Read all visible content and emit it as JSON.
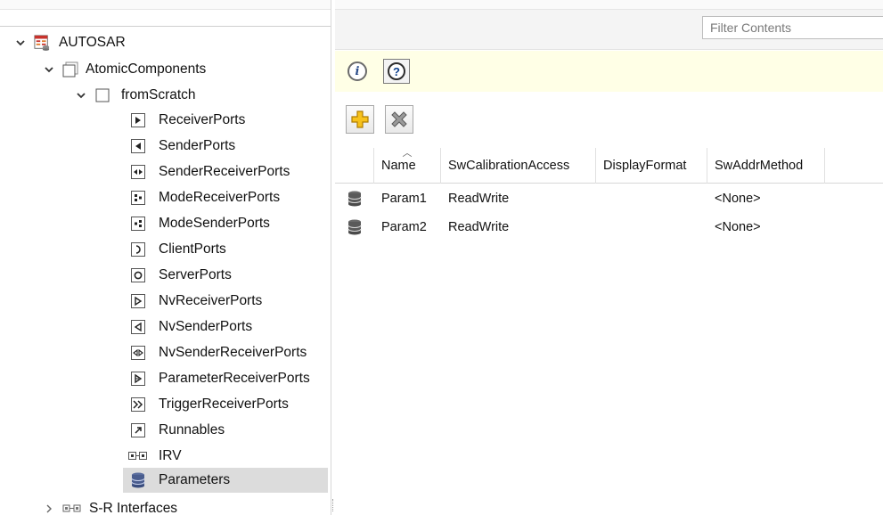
{
  "tree": {
    "nodes": [
      {
        "label": "AUTOSAR",
        "icon": "autosar-package-icon",
        "expanded": true
      },
      {
        "label": "AtomicComponents",
        "icon": "folder-outline-icon",
        "expanded": true
      },
      {
        "label": "fromScratch",
        "icon": "component-icon",
        "expanded": true
      },
      {
        "label": "ReceiverPorts",
        "icon": "receiver-port-icon"
      },
      {
        "label": "SenderPorts",
        "icon": "sender-port-icon"
      },
      {
        "label": "SenderReceiverPorts",
        "icon": "sender-receiver-port-icon"
      },
      {
        "label": "ModeReceiverPorts",
        "icon": "mode-receiver-port-icon"
      },
      {
        "label": "ModeSenderPorts",
        "icon": "mode-sender-port-icon"
      },
      {
        "label": "ClientPorts",
        "icon": "client-port-icon"
      },
      {
        "label": "ServerPorts",
        "icon": "server-port-icon"
      },
      {
        "label": "NvReceiverPorts",
        "icon": "nv-receiver-port-icon"
      },
      {
        "label": "NvSenderPorts",
        "icon": "nv-sender-port-icon"
      },
      {
        "label": "NvSenderReceiverPorts",
        "icon": "nv-sender-receiver-port-icon"
      },
      {
        "label": "ParameterReceiverPorts",
        "icon": "parameter-receiver-port-icon"
      },
      {
        "label": "TriggerReceiverPorts",
        "icon": "trigger-receiver-port-icon"
      },
      {
        "label": "Runnables",
        "icon": "runnable-icon"
      },
      {
        "label": "IRV",
        "icon": "irv-icon"
      },
      {
        "label": "Parameters",
        "icon": "database-icon",
        "selected": true
      },
      {
        "label": "S-R Interfaces",
        "icon": "interfaces-icon",
        "expanded": false
      }
    ]
  },
  "filter": {
    "placeholder": "Filter Contents"
  },
  "info_bar": {
    "info_icon": "info-icon",
    "help_icon": "help-icon"
  },
  "toolbar": {
    "add_icon": "add-icon",
    "delete_icon": "delete-icon"
  },
  "table": {
    "columns": [
      "Name",
      "SwCalibrationAccess",
      "DisplayFormat",
      "SwAddrMethod"
    ],
    "sorted_column": "Name",
    "rows": [
      {
        "name": "Param1",
        "access": "ReadWrite",
        "format": "",
        "addr": "<None>"
      },
      {
        "name": "Param2",
        "access": "ReadWrite",
        "format": "",
        "addr": "<None>"
      }
    ]
  },
  "colors": {
    "info_bar_bg": "#ffffe6",
    "selection_bg": "#dcdcdc",
    "add_icon": "#f5b800",
    "delete_icon": "#8a8a8a"
  }
}
